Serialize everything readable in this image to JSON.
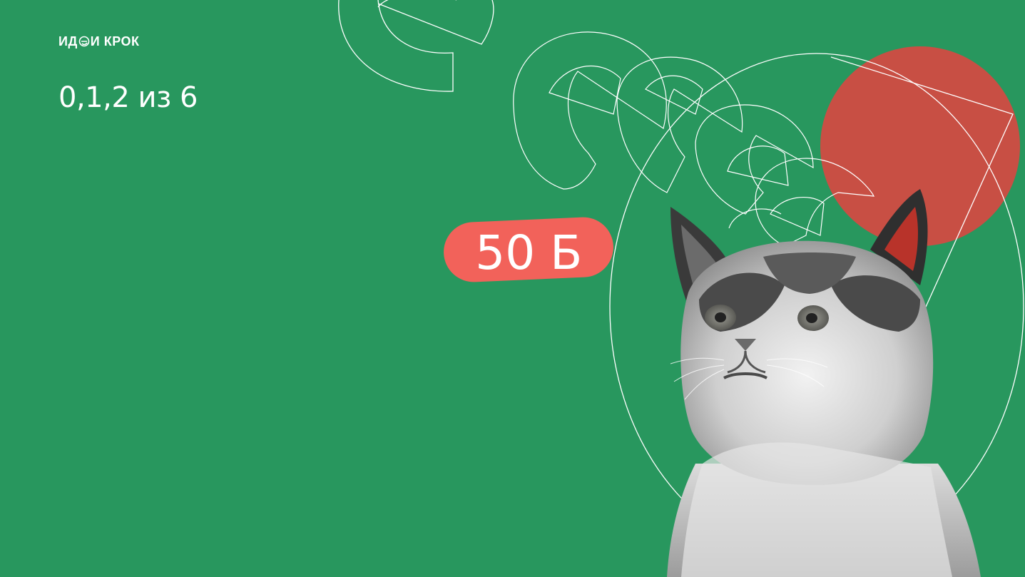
{
  "brand": {
    "logo_left": "ИД",
    "logo_right": "И КРОК"
  },
  "slide": {
    "question": "0,1,2 из 6",
    "points": "50 Б"
  },
  "colors": {
    "background": "#28975e",
    "points_badge": "#f2625a",
    "circle": "#c84f44",
    "outline": "#ffffff"
  },
  "decorations": {
    "outline_icon": "outline-letter-shapes",
    "photo": "grumpy-cat-photo"
  }
}
